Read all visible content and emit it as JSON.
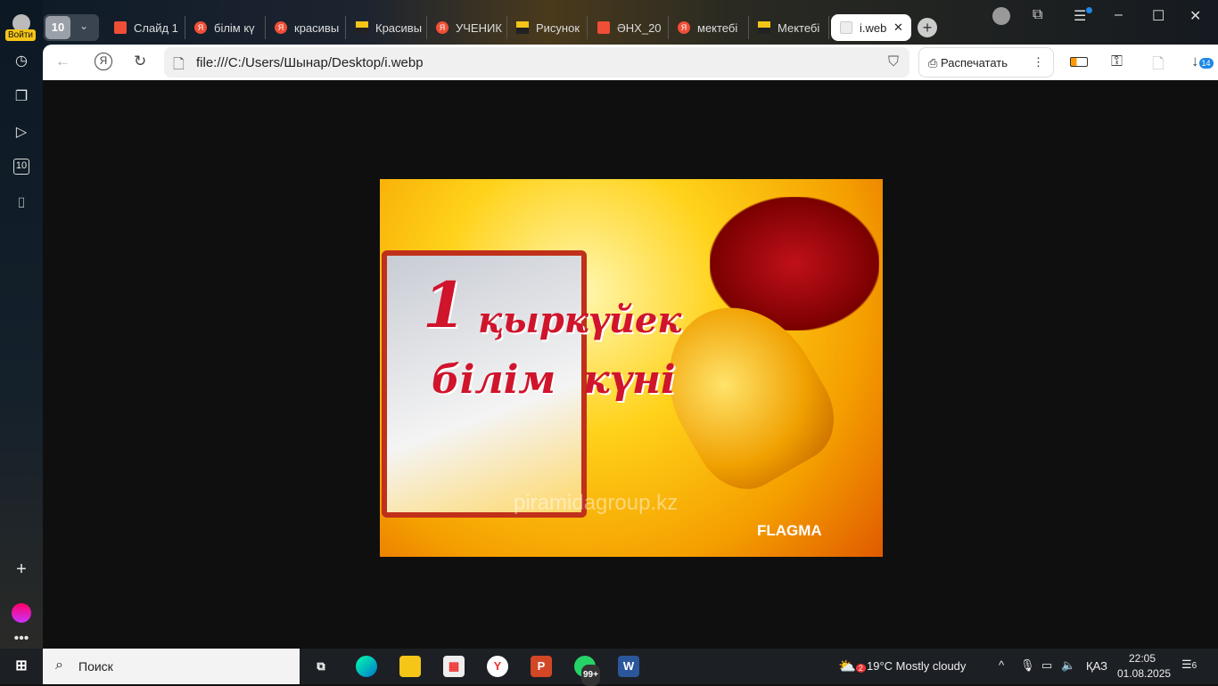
{
  "sidebar": {
    "login": "Войти"
  },
  "tabs": {
    "count": "10",
    "items": [
      {
        "label": "Слайд 1",
        "icon": "pdf"
      },
      {
        "label": "білім кү",
        "icon": "yandex"
      },
      {
        "label": "красивы",
        "icon": "yandex"
      },
      {
        "label": "Красивы",
        "icon": "image"
      },
      {
        "label": "УЧЕНИК",
        "icon": "yandex"
      },
      {
        "label": "Рисунок",
        "icon": "image"
      },
      {
        "label": "ӘНХ_20",
        "icon": "pdf"
      },
      {
        "label": "мектебі",
        "icon": "yandex"
      },
      {
        "label": "Мектебі",
        "icon": "image"
      },
      {
        "label": "i.webp",
        "icon": "file"
      }
    ]
  },
  "toolbar": {
    "url": "file:///C:/Users/Шынар/Desktop/i.webp",
    "print": "Распечатать",
    "downloads_badge": "14"
  },
  "image": {
    "line1": "1",
    "line2": "қыркүйек",
    "line3": "білім  күні",
    "watermark": "piramidagroup.kz",
    "brand": "FLAGMA"
  },
  "taskbar": {
    "search": "Поиск",
    "whatsapp_badge": "99+",
    "weather_badge": "2",
    "weather": "19°C  Mostly cloudy",
    "lang": "ҚАЗ",
    "time": "22:05",
    "date": "01.08.2025",
    "notif": "6"
  }
}
